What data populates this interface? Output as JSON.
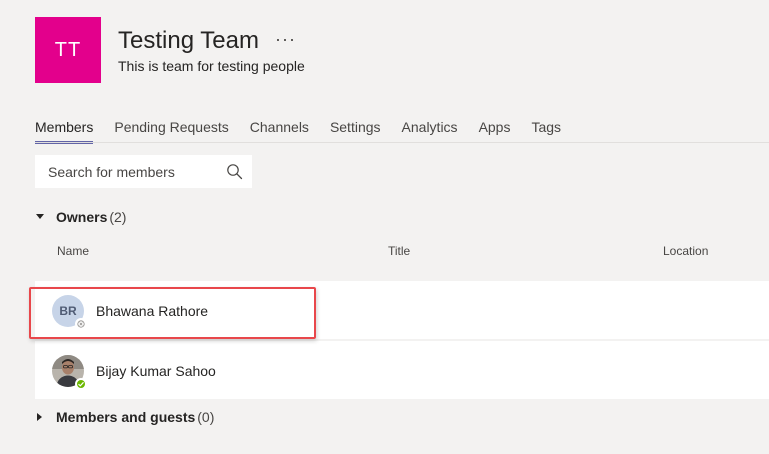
{
  "team": {
    "initials": "TT",
    "name": "Testing Team",
    "more_label": "···",
    "description": "This is team for testing people",
    "avatar_color": "#e3008c"
  },
  "tabs": [
    {
      "label": "Members",
      "active": true
    },
    {
      "label": "Pending Requests",
      "active": false
    },
    {
      "label": "Channels",
      "active": false
    },
    {
      "label": "Settings",
      "active": false
    },
    {
      "label": "Analytics",
      "active": false
    },
    {
      "label": "Apps",
      "active": false
    },
    {
      "label": "Tags",
      "active": false
    }
  ],
  "search": {
    "placeholder": "Search for members",
    "icon": "search-icon"
  },
  "owners": {
    "title": "Owners",
    "count": "(2)",
    "expanded": true,
    "columns": [
      "Name",
      "Title",
      "Location"
    ],
    "members": [
      {
        "initials": "BR",
        "name": "Bhawana Rathore",
        "status": "offline",
        "avatar": "initials"
      },
      {
        "initials": "",
        "name": "Bijay Kumar Sahoo",
        "status": "available",
        "avatar": "photo"
      }
    ]
  },
  "members_and_guests": {
    "title": "Members and guests",
    "count": "(0)",
    "expanded": false
  },
  "colors": {
    "accent": "#6264a7",
    "highlight": "#e8474b",
    "available": "#6bb700"
  }
}
